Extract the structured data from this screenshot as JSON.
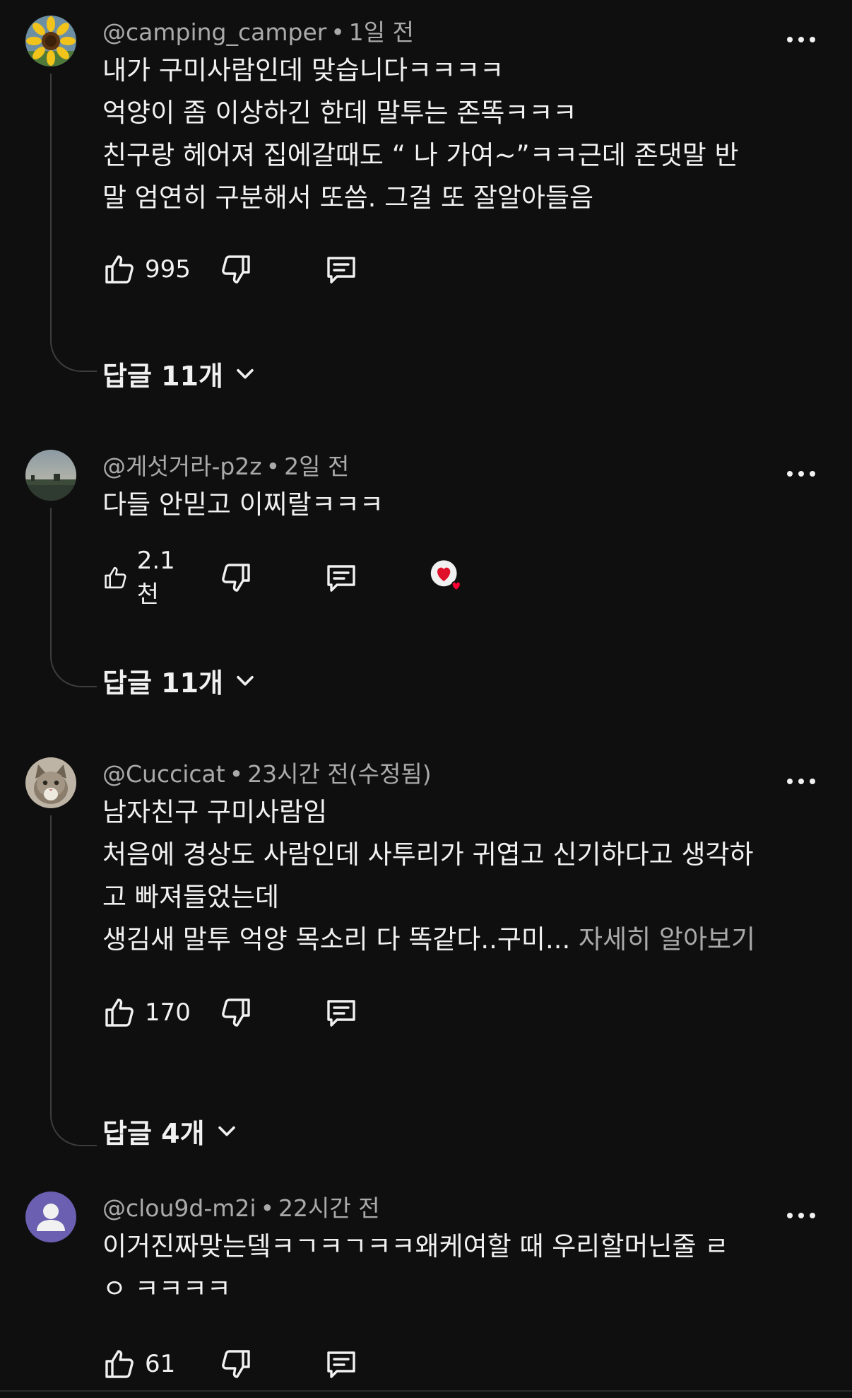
{
  "comments": [
    {
      "handle": "@camping_camper",
      "time": "1일 전",
      "lines": [
        "내가 구미사람인데 맞습니다ㅋㅋㅋㅋ",
        "억양이 좀 이상하긴 한데 말투는 존똑ㅋㅋㅋ",
        "친구랑 헤어져 집에갈때도 “ 나 가여~”ㅋㅋ근데 존댓말 반",
        "말 엄연히 구분해서 또씀. 그걸 또 잘알아들음"
      ],
      "likes": "995",
      "replies": "답글 11개",
      "avatar": "sunflower-avatar"
    },
    {
      "handle": "@게섯거라-p2z",
      "time": "2일 전",
      "lines": [
        "다들 안믿고 이찌랄ㅋㅋㅋ"
      ],
      "likes": "2.1천",
      "replies": "답글 11개",
      "avatar": "landscape-avatar"
    },
    {
      "handle": "@Cuccicat",
      "time": "23시간 전(수정됨)",
      "lines": [
        "남자친구 구미사람임",
        "처음에 경상도 사람인데 사투리가 귀엽고 신기하다고 생각하",
        "고 빠져들었는데"
      ],
      "last_line": "생김새 말투 억양 목소리 다 똑같다..구미...",
      "read_more": "자세히 알아보기",
      "likes": "170",
      "replies": "답글 4개",
      "avatar": "cat-avatar"
    },
    {
      "handle": "@clou9d-m2i",
      "time": "22시간 전",
      "lines": [
        "이거진짜맞는뎈ㅋㄱㅋㄱㅋㅋ왜케여할 때 우리할머닌줄 ㄹ",
        "ㅇ ㅋㅋㅋㅋ"
      ],
      "likes": "61",
      "avatar": "default-user-avatar"
    }
  ],
  "icons": {
    "like": "thumbs-up-icon",
    "dislike": "thumbs-down-icon",
    "reply": "comment-icon",
    "more": "more-dots-icon",
    "expand": "chevron-down-icon",
    "creator_heart": "creator-heart-icon"
  },
  "colors": {
    "background": "#0f0f0f",
    "text": "#f1f1f1",
    "secondary": "#aaaaaa",
    "heart": "#ff0033"
  }
}
